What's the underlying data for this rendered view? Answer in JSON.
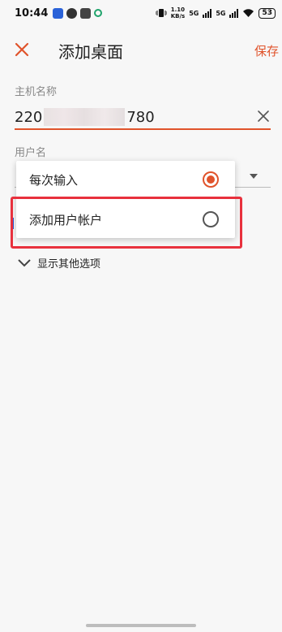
{
  "status_bar": {
    "time": "10:44",
    "net_speed": "1.10\nKB/s",
    "signal_1": "5G",
    "signal_2": "5G",
    "battery": "53"
  },
  "header": {
    "title": "添加桌面",
    "save_label": "保存",
    "accent_color": "#e0532b"
  },
  "host": {
    "label": "主机名称",
    "value_prefix": "220",
    "value_suffix": "780"
  },
  "user": {
    "label": "用户名"
  },
  "popup": {
    "options": [
      {
        "label": "每次输入",
        "selected": true
      },
      {
        "label": "添加用户帐户",
        "selected": false
      }
    ]
  },
  "more_options_label": "显示其他选项"
}
